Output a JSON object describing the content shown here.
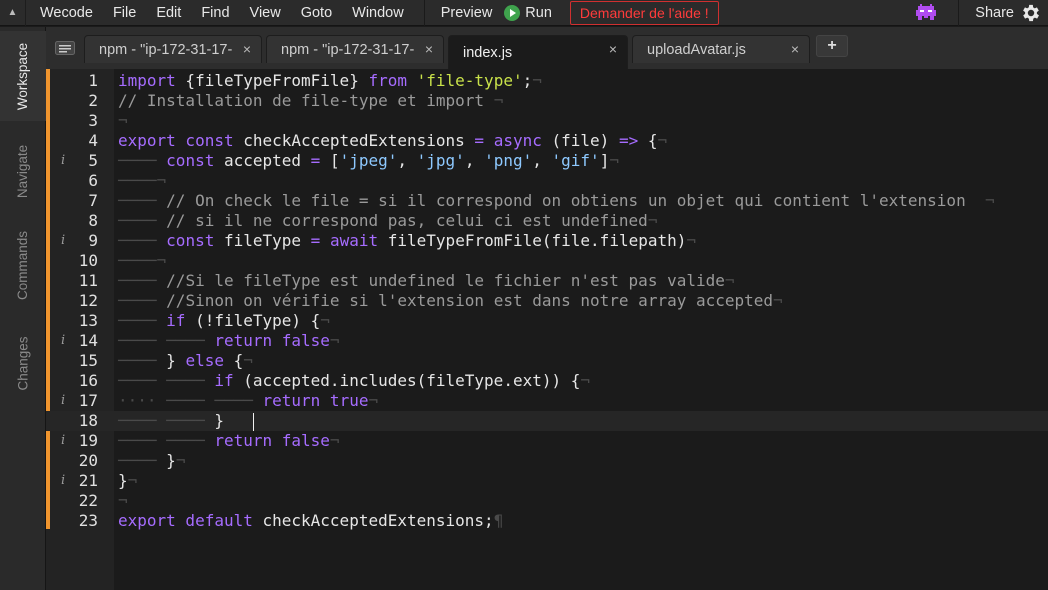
{
  "menubar": {
    "items": [
      "Wecode",
      "File",
      "Edit",
      "Find",
      "View",
      "Goto",
      "Window"
    ],
    "preview": "Preview",
    "run": "Run",
    "help": "Demander de l'aide !",
    "share": "Share"
  },
  "sidebar": {
    "tabs": [
      "Workspace",
      "Navigate",
      "Commands",
      "Changes"
    ]
  },
  "tabs": [
    {
      "label": "npm - \"ip-172-31-17-",
      "active": false
    },
    {
      "label": "npm - \"ip-172-31-17-",
      "active": false
    },
    {
      "label": "index.js",
      "active": true
    },
    {
      "label": "uploadAvatar.js",
      "active": false
    }
  ],
  "tab_close_symbol": "×",
  "add_tab_symbol": "+",
  "editor": {
    "current_line": 18,
    "lines": [
      {
        "n": "1",
        "marker": "",
        "html": "<span class=\"kw\">import</span><span class=\"tx\"> {fileTypeFromFile} </span><span class=\"kw\">from</span><span class=\"tx\"> </span><span class=\"str2\">'file-type'</span><span class=\"tx\">;</span><span class=\"inv\">¬</span>"
      },
      {
        "n": "2",
        "marker": "",
        "html": "<span class=\"cm\">// Installation de file-type et import </span><span class=\"inv\">¬</span>"
      },
      {
        "n": "3",
        "marker": "",
        "html": "<span class=\"inv\">¬</span>"
      },
      {
        "n": "4",
        "marker": "",
        "html": "<span class=\"kw\">export const</span><span class=\"tx\"> checkAcceptedExtensions </span><span class=\"kw\">=</span><span class=\"tx\"> </span><span class=\"kw\">async</span><span class=\"tx\"> (file) </span><span class=\"kw\">=&gt;</span><span class=\"tx\"> {</span><span class=\"inv\">¬</span>"
      },
      {
        "n": "5",
        "marker": "i",
        "html": "<span class=\"inv\">──── </span><span class=\"kw\">const</span><span class=\"tx\"> accepted </span><span class=\"kw\">=</span><span class=\"tx\"> [</span><span class=\"str\">'jpeg'</span><span class=\"tx\">, </span><span class=\"str\">'jpg'</span><span class=\"tx\">, </span><span class=\"str\">'png'</span><span class=\"tx\">, </span><span class=\"str\">'gif'</span><span class=\"tx\">]</span><span class=\"inv\">¬</span>"
      },
      {
        "n": "6",
        "marker": "",
        "html": "<span class=\"inv\">────¬</span>"
      },
      {
        "n": "7",
        "marker": "",
        "html": "<span class=\"inv\">──── </span><span class=\"cm\">// On check le file = si il correspond on obtiens un objet qui contient l'extension  </span><span class=\"inv\">¬</span>"
      },
      {
        "n": "8",
        "marker": "",
        "html": "<span class=\"inv\">──── </span><span class=\"cm\">// si il ne correspond pas, celui ci est undefined</span><span class=\"inv\">¬</span>"
      },
      {
        "n": "9",
        "marker": "i",
        "html": "<span class=\"inv\">──── </span><span class=\"kw\">const</span><span class=\"tx\"> fileType </span><span class=\"kw\">=</span><span class=\"tx\"> </span><span class=\"kw\">await</span><span class=\"tx\"> fileTypeFromFile(file.filepath)</span><span class=\"inv\">¬</span>"
      },
      {
        "n": "10",
        "marker": "",
        "html": "<span class=\"inv\">────¬</span>"
      },
      {
        "n": "11",
        "marker": "",
        "html": "<span class=\"inv\">──── </span><span class=\"cm\">//Si le fileType est undefined le fichier n'est pas valide</span><span class=\"inv\">¬</span>"
      },
      {
        "n": "12",
        "marker": "",
        "html": "<span class=\"inv\">──── </span><span class=\"cm\">//Sinon on vérifie si l'extension est dans notre array accepted</span><span class=\"inv\">¬</span>"
      },
      {
        "n": "13",
        "marker": "",
        "html": "<span class=\"inv\">──── </span><span class=\"kw\">if</span><span class=\"tx\"> (!fileType) {</span><span class=\"inv\">¬</span>"
      },
      {
        "n": "14",
        "marker": "i",
        "html": "<span class=\"inv\">──── ──── </span><span class=\"kw\">return false</span><span class=\"inv\">¬</span>"
      },
      {
        "n": "15",
        "marker": "",
        "html": "<span class=\"inv\">──── </span><span class=\"tx\">} </span><span class=\"kw\">else</span><span class=\"tx\"> {</span><span class=\"inv\">¬</span>"
      },
      {
        "n": "16",
        "marker": "",
        "html": "<span class=\"inv\">──── ──── </span><span class=\"kw\">if</span><span class=\"tx\"> (accepted.includes(fileType.ext)) {</span><span class=\"inv\">¬</span>"
      },
      {
        "n": "17",
        "marker": "i",
        "html": "<span class=\"inv\">···· ──── ──── </span><span class=\"kw\">return true</span><span class=\"inv\">¬</span>"
      },
      {
        "n": "18",
        "marker": "",
        "html": "<span class=\"inv\">──── ──── </span><span class=\"tx\">}   </span><span class=\"cursor\"></span>"
      },
      {
        "n": "19",
        "marker": "i",
        "html": "<span class=\"inv\">──── ──── </span><span class=\"kw\">return false</span><span class=\"inv\">¬</span>"
      },
      {
        "n": "20",
        "marker": "",
        "html": "<span class=\"inv\">──── </span><span class=\"tx\">}</span><span class=\"inv\">¬</span>"
      },
      {
        "n": "21",
        "marker": "i",
        "html": "<span class=\"tx\">}</span><span class=\"inv\">¬</span>"
      },
      {
        "n": "22",
        "marker": "",
        "html": "<span class=\"inv\">¬</span>"
      },
      {
        "n": "23",
        "marker": "",
        "html": "<span class=\"kw\">export default</span><span class=\"tx\"> checkAcceptedExtensions;</span><span class=\"inv\">¶</span>"
      }
    ]
  },
  "colors": {
    "keyword": "#a66cff",
    "string": "#8ec9ff",
    "module_string": "#c9e24a",
    "comment": "#9a9a9a",
    "gutter_accent": "#f0952e",
    "help_red": "#ff3b3b",
    "run_green": "#3fa34d"
  }
}
